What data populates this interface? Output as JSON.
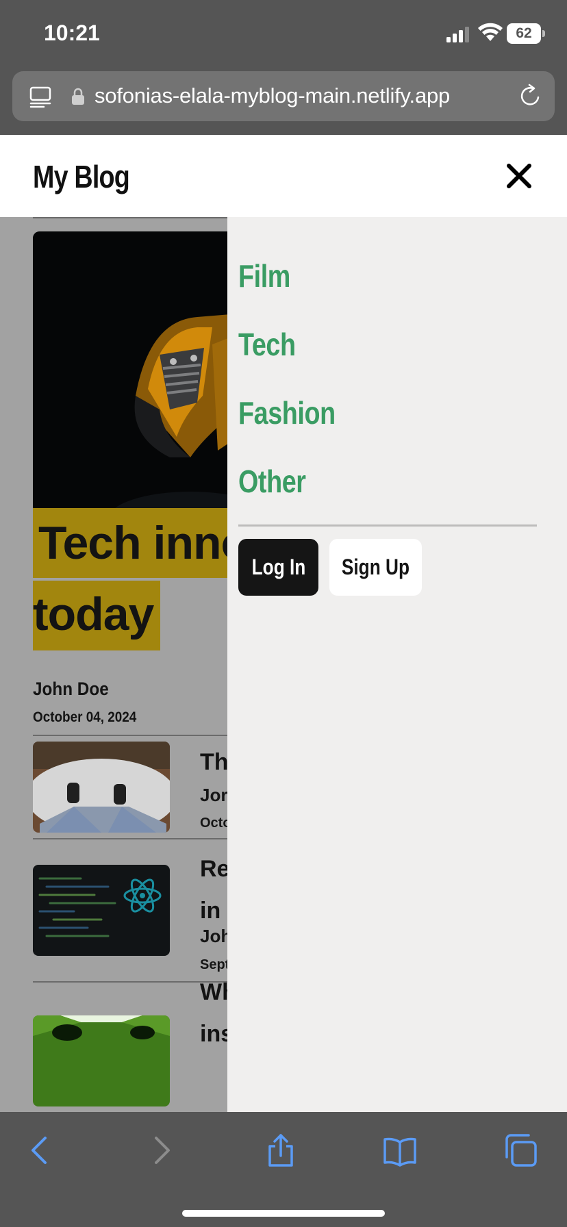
{
  "status_bar": {
    "time": "10:21",
    "battery": "62",
    "icons": [
      "cellular-signal-icon",
      "wifi-icon",
      "battery-icon"
    ]
  },
  "browser": {
    "url": "sofonias-elala-myblog-main.netlify.app",
    "icons": [
      "page-menu-icon",
      "lock-icon",
      "reload-icon"
    ],
    "toolbar_icons": [
      "back-icon",
      "forward-icon",
      "share-icon",
      "bookmarks-icon",
      "tabs-icon"
    ],
    "accent_color": "#5b9bf5"
  },
  "header": {
    "title": "My Blog",
    "close_icon": "close-icon"
  },
  "featured": {
    "headline_line1": "Tech inno",
    "headline_line2": "today",
    "author": "John Doe",
    "date": "October 04, 2024",
    "highlight_color": "#a2860e"
  },
  "posts": [
    {
      "title": "The",
      "author": "Jord",
      "date": "Octo"
    },
    {
      "title_line1": "Re",
      "title_line2": "in",
      "author": "Joh",
      "date": "Septe"
    },
    {
      "title_line1": "Wh",
      "title_line2": "ins"
    }
  ],
  "menu": {
    "items": [
      "Film",
      "Tech",
      "Fashion",
      "Other"
    ],
    "login_label": "Log In",
    "signup_label": "Sign Up",
    "item_color": "#3a9c63"
  }
}
